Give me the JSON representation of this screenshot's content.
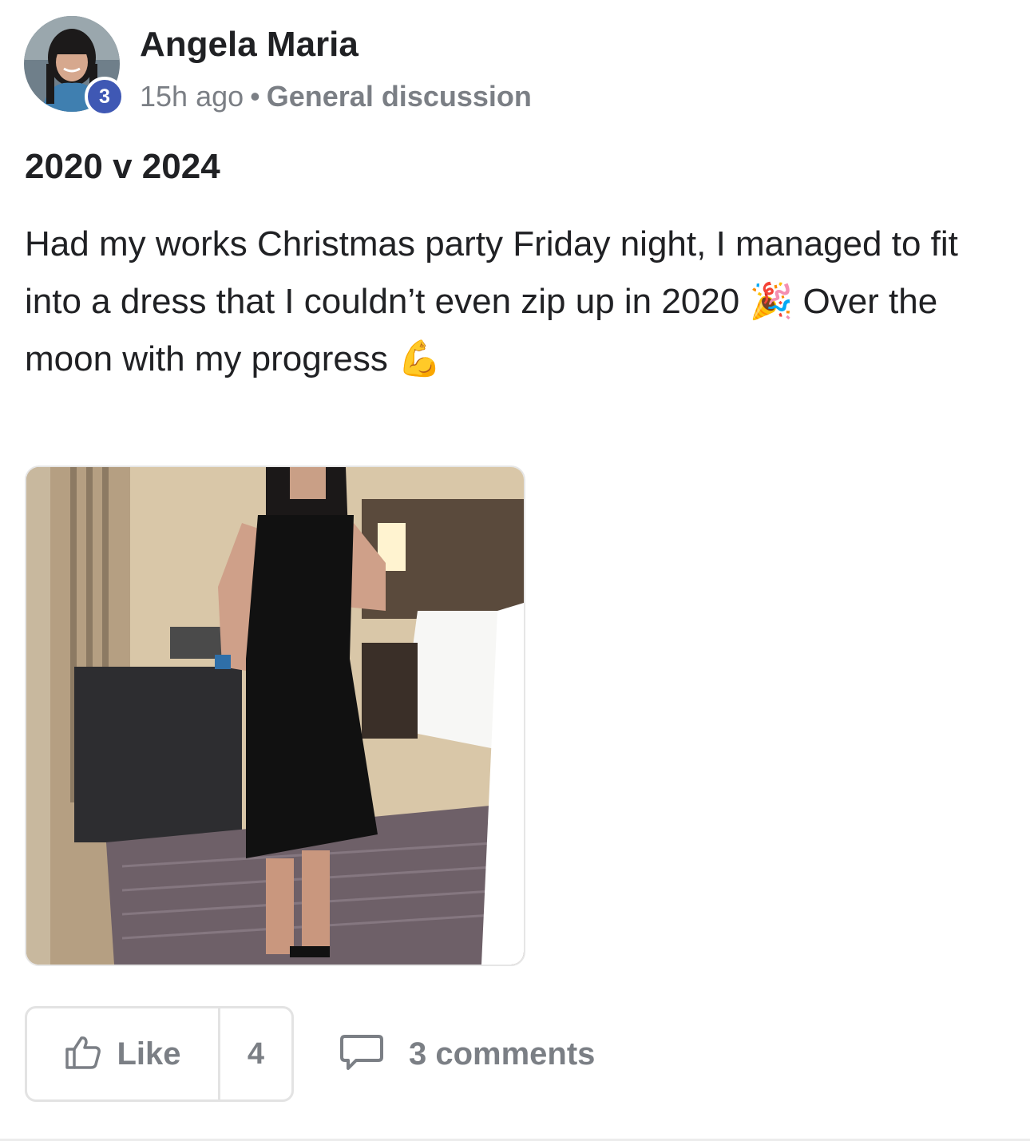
{
  "post": {
    "author": {
      "name": "Angela Maria",
      "level": "3",
      "avatar_icon": "user-avatar-photo"
    },
    "meta": {
      "time": "15h ago",
      "separator": "•",
      "category": "General discussion"
    },
    "title": "2020 v 2024",
    "body": "Had my works Christmas party Friday night, I managed to fit into a dress that I couldn’t even zip up in 2020 🎉 Over the moon with my progress 💪",
    "image_icon": "post-photo"
  },
  "actions": {
    "like_label": "Like",
    "like_icon": "thumbs-up-icon",
    "like_count": "4",
    "comments_label": "3 comments",
    "comments_icon": "comment-bubble-icon"
  },
  "colors": {
    "badge": "#3f58b4",
    "muted": "#7b7f85",
    "text": "#202124",
    "border": "#e3e3e3"
  }
}
